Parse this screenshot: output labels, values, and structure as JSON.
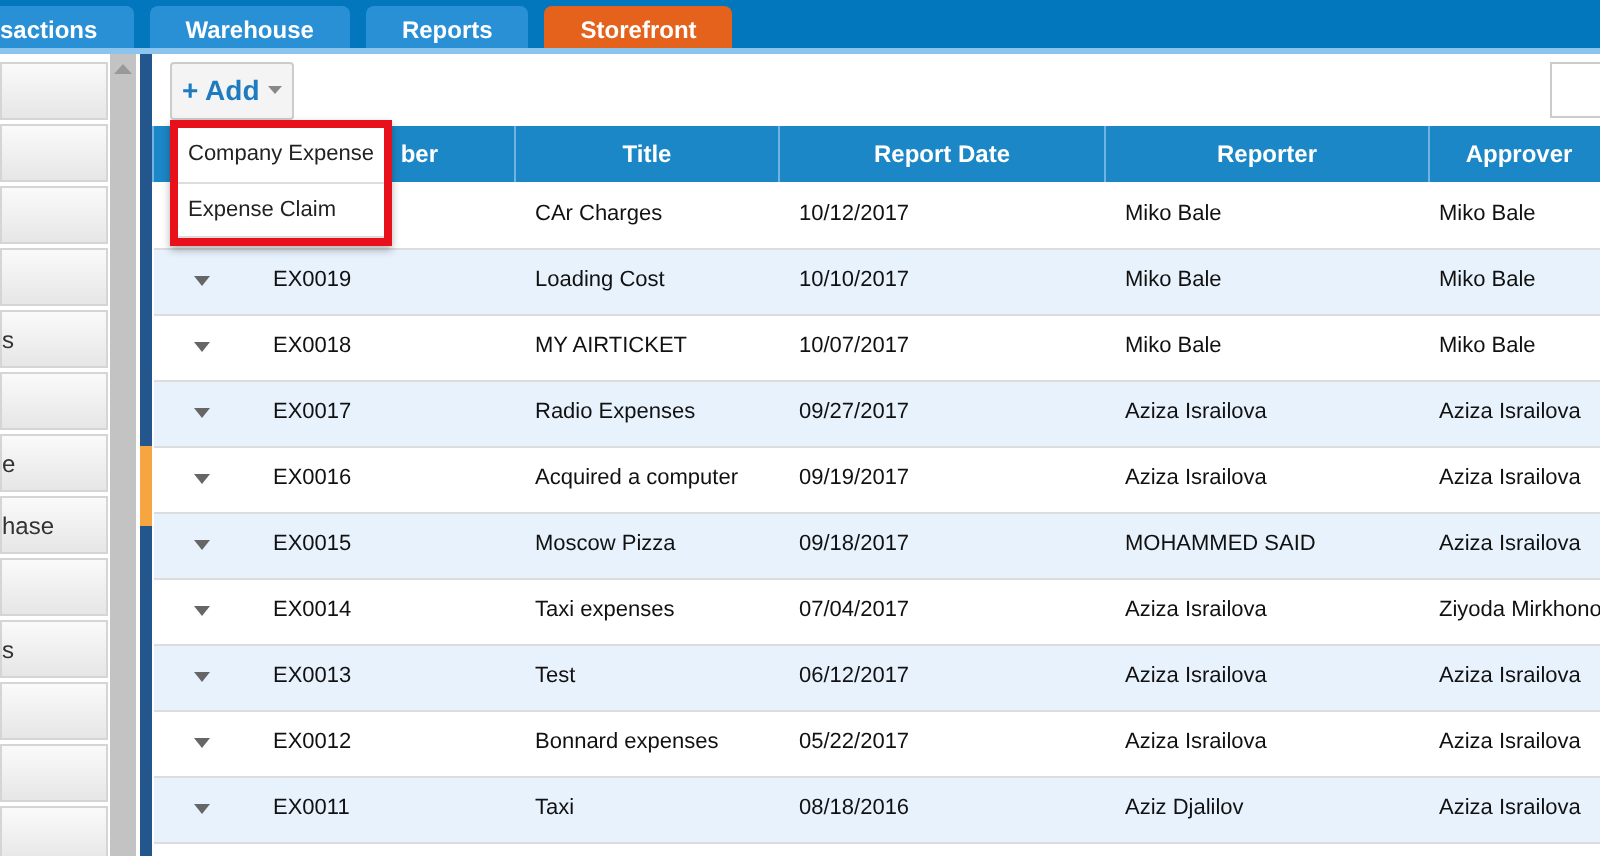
{
  "tabs": [
    {
      "label": "sactions",
      "selected": false
    },
    {
      "label": "Warehouse",
      "selected": false
    },
    {
      "label": "Reports",
      "selected": false
    },
    {
      "label": "Storefront",
      "selected": true
    }
  ],
  "sidebar": {
    "items": [
      {
        "kind": "button"
      },
      {
        "kind": "button"
      },
      {
        "kind": "button"
      },
      {
        "kind": "button"
      },
      {
        "kind": "button",
        "label": "s"
      },
      {
        "kind": "button"
      },
      {
        "kind": "button",
        "label": "e"
      },
      {
        "kind": "button",
        "label": "hase"
      },
      {
        "kind": "button"
      },
      {
        "kind": "button",
        "label": "s"
      },
      {
        "kind": "button"
      },
      {
        "kind": "button"
      },
      {
        "kind": "button"
      }
    ]
  },
  "toolbar": {
    "add_button": "+ Add",
    "add_menu": [
      "Company Expense",
      "Expense Claim"
    ]
  },
  "table": {
    "columns": [
      "ber",
      "Title",
      "Report Date",
      "Reporter",
      "Approver"
    ],
    "rows": [
      [
        "",
        "CAr Charges",
        "10/12/2017",
        "Miko Bale",
        "Miko Bale"
      ],
      [
        "EX0019",
        "Loading Cost",
        "10/10/2017",
        "Miko Bale",
        "Miko Bale"
      ],
      [
        "EX0018",
        "MY AIRTICKET",
        "10/07/2017",
        "Miko Bale",
        "Miko Bale"
      ],
      [
        "EX0017",
        "Radio Expenses",
        "09/27/2017",
        "Aziza Israilova",
        "Aziza Israilova"
      ],
      [
        "EX0016",
        "Acquired a computer",
        "09/19/2017",
        "Aziza Israilova",
        "Aziza Israilova"
      ],
      [
        "EX0015",
        "Moscow Pizza",
        "09/18/2017",
        "MOHAMMED SAID",
        "Aziza Israilova"
      ],
      [
        "EX0014",
        "Taxi expenses",
        "07/04/2017",
        "Aziza Israilova",
        "Ziyoda Mirkhono"
      ],
      [
        "EX0013",
        "Test",
        "06/12/2017",
        "Aziza Israilova",
        "Aziza Israilova"
      ],
      [
        "EX0012",
        "Bonnard expenses",
        "05/22/2017",
        "Aziza Israilova",
        "Aziza Israilova"
      ],
      [
        "EX0011",
        "Taxi",
        "08/18/2016",
        "Aziz Djalilov",
        "Aziza Israilova"
      ]
    ]
  }
}
